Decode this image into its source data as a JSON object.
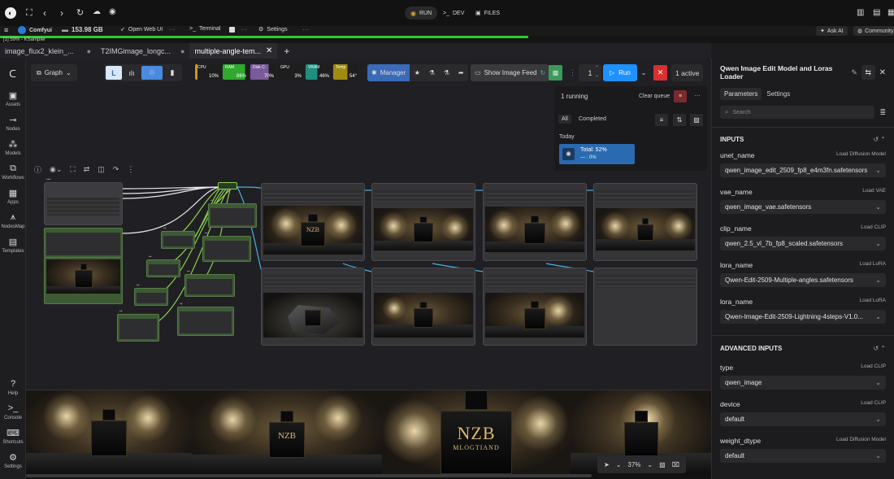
{
  "topbar": {
    "run_label": "RUN",
    "dev_label": "DEV",
    "files_label": "FILES"
  },
  "bar2": {
    "app_name": "Comfyui",
    "storage": "153.98 GB",
    "open_webui": "Open Web UI",
    "terminal": "Terminal",
    "settings": "Settings",
    "ask_ai": "Ask AI",
    "community": "Community"
  },
  "progress": {
    "text": "[1] 59% - KSampler",
    "value_percent": 59
  },
  "tabs": [
    {
      "label": "image_flux2_klein_..."
    },
    {
      "label": "T2IMGimage_longc..."
    },
    {
      "label": "multiple-angle-tem..."
    }
  ],
  "leftnav": [
    {
      "label": "Assets",
      "icon": "image-icon"
    },
    {
      "label": "Nodes",
      "icon": "nodes-icon"
    },
    {
      "label": "Models",
      "icon": "models-icon"
    },
    {
      "label": "Workflows",
      "icon": "workflows-icon"
    },
    {
      "label": "Apps",
      "icon": "apps-icon"
    },
    {
      "label": "NodesMap",
      "icon": "nodesmap-icon"
    },
    {
      "label": "Templates",
      "icon": "templates-icon"
    }
  ],
  "leftnav_bottom": [
    {
      "label": "Help",
      "icon": "help-icon"
    },
    {
      "label": "Console",
      "icon": "console-icon"
    },
    {
      "label": "Shortcuts",
      "icon": "keyboard-icon"
    },
    {
      "label": "Settings",
      "icon": "gear-icon"
    }
  ],
  "toolbar": {
    "graph_label": "Graph",
    "manager_label": "Manager",
    "show_feed_label": "Show Image Feed",
    "queue_count": "1",
    "run_label": "Run",
    "active_label": "1 active"
  },
  "monitors": [
    {
      "label": "CPU",
      "value": "10%",
      "color": "#c49a2a"
    },
    {
      "label": "RAM",
      "value": "86%",
      "color": "#2faa2f"
    },
    {
      "label": "Disk C:",
      "value": "70%",
      "color": "#7a5a9a"
    },
    {
      "label": "GPU",
      "value": "3%",
      "color": "#2a2a2a"
    },
    {
      "label": "VRAM",
      "value": "46%",
      "color": "#1f8f7f"
    },
    {
      "label": "Temp",
      "value": "54°",
      "color": "#a08a10"
    }
  ],
  "queue": {
    "title": "1 running",
    "clear_label": "Clear queue",
    "filter_all": "All",
    "filter_completed": "Completed",
    "today": "Today",
    "job_total": "Total: 52%",
    "job_sub": "— : 0%"
  },
  "zoom": {
    "value": "37%"
  },
  "panel": {
    "title": "Qwen Image Edit Model and Loras Loader",
    "tab_parameters": "Parameters",
    "tab_settings": "Settings",
    "search_placeholder": "Search",
    "inputs_heading": "INPUTS",
    "advanced_heading": "ADVANCED INPUTS",
    "inputs": [
      {
        "name": "unet_name",
        "source": "Load Diffusion Model",
        "value": "qwen_image_edit_2509_fp8_e4m3fn.safetensors"
      },
      {
        "name": "vae_name",
        "source": "Load VAE",
        "value": "qwen_image_vae.safetensors"
      },
      {
        "name": "clip_name",
        "source": "Load CLIP",
        "value": "qwen_2.5_vl_7b_fp8_scaled.safetensors"
      },
      {
        "name": "lora_name",
        "source": "Load LoRA",
        "value": "Qwen-Edit-2509-Multiple-angles.safetensors"
      },
      {
        "name": "lora_name",
        "source": "Load LoRA",
        "value": "Qwen-Image-Edit-2509-Lightning-4steps-V1.0..."
      }
    ],
    "advanced": [
      {
        "name": "type",
        "source": "Load CLIP",
        "value": "qwen_image"
      },
      {
        "name": "device",
        "source": "Load CLIP",
        "value": "default"
      },
      {
        "name": "weight_dtype",
        "source": "Load Diffusion Model",
        "value": "default"
      }
    ]
  },
  "products": {
    "brand": "NZB",
    "subbrand": "MLOGTIAND"
  },
  "colors": {
    "accent_blue": "#2b8ad8",
    "run_blue": "#1e90ff",
    "progress_green": "#2ecc2e",
    "stop_red": "#d83030"
  }
}
